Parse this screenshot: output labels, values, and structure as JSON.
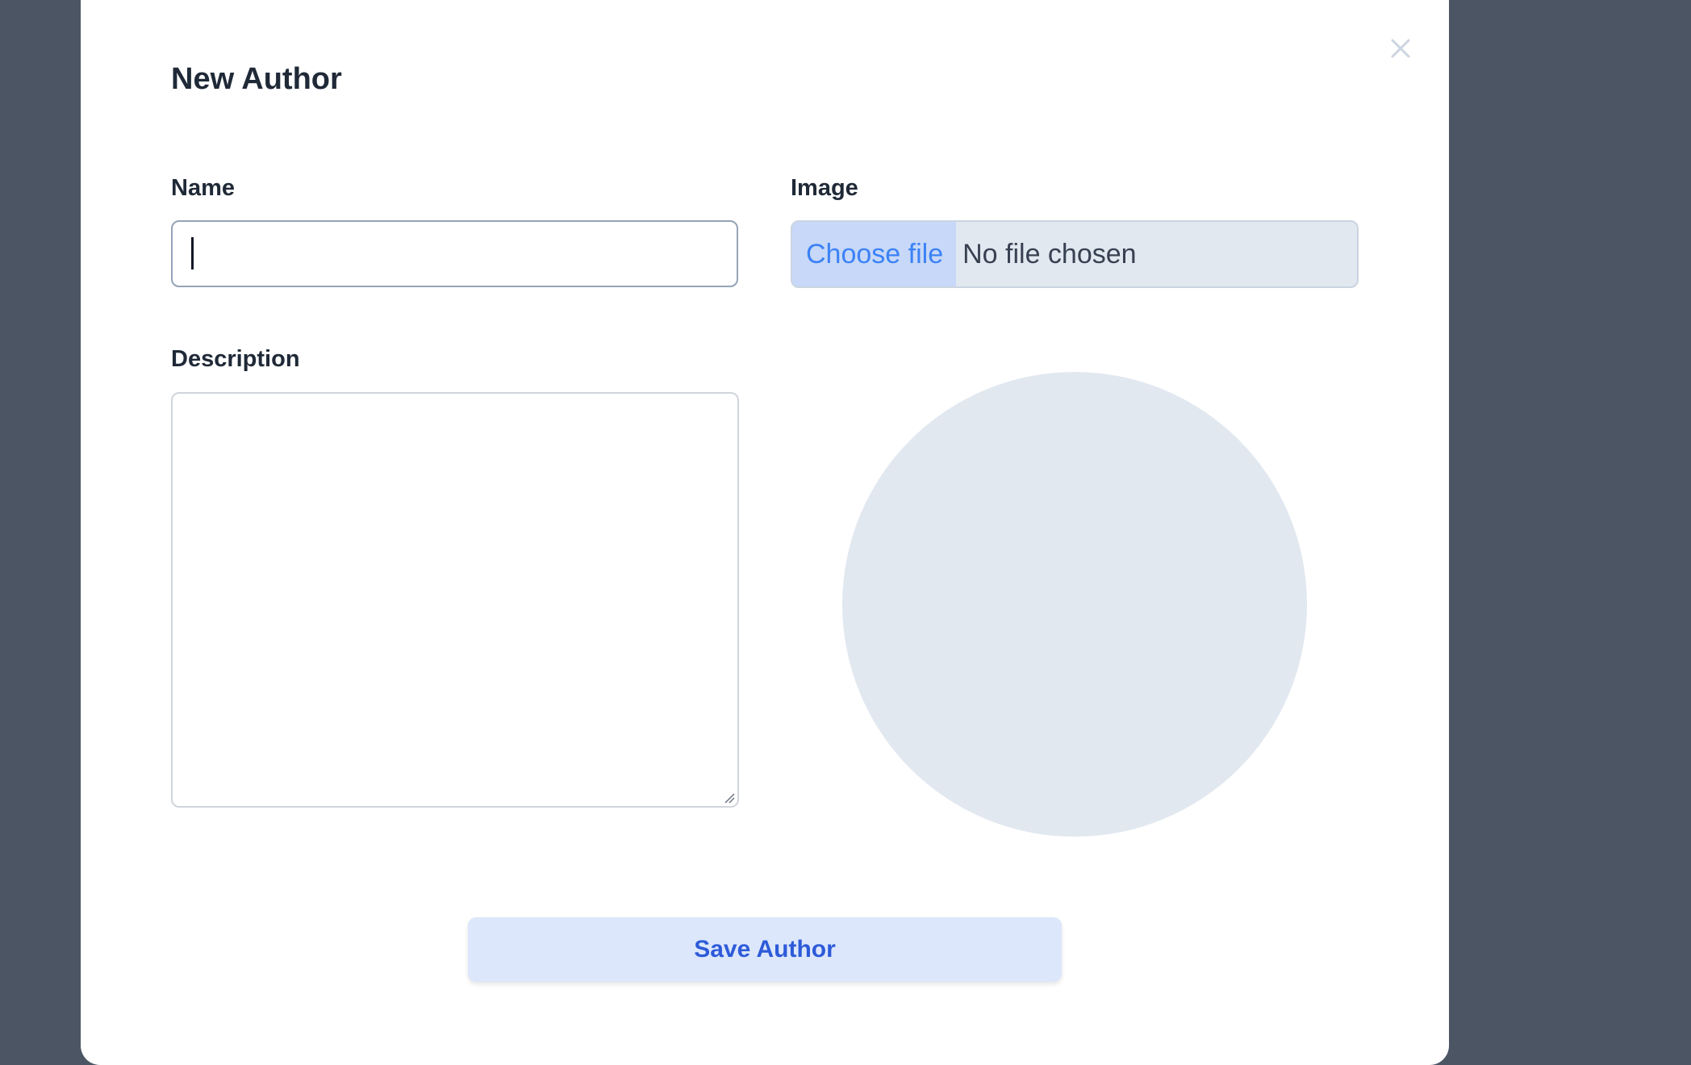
{
  "modal": {
    "title": "New Author",
    "close_icon": "close-icon"
  },
  "form": {
    "name": {
      "label": "Name",
      "value": ""
    },
    "image": {
      "label": "Image",
      "button_label": "Choose file",
      "status": "No file chosen"
    },
    "description": {
      "label": "Description",
      "value": ""
    },
    "avatar_preview": {
      "icon": "avatar-placeholder"
    },
    "submit_label": "Save Author"
  },
  "colors": {
    "backdrop": "#4b5563",
    "modal_bg": "#ffffff",
    "text_primary": "#1f2937",
    "accent": "#2d5bd9",
    "file_button_text": "#3b82f6",
    "placeholder_circle": "#e2e8f0",
    "save_button_bg": "#dde7fb"
  }
}
